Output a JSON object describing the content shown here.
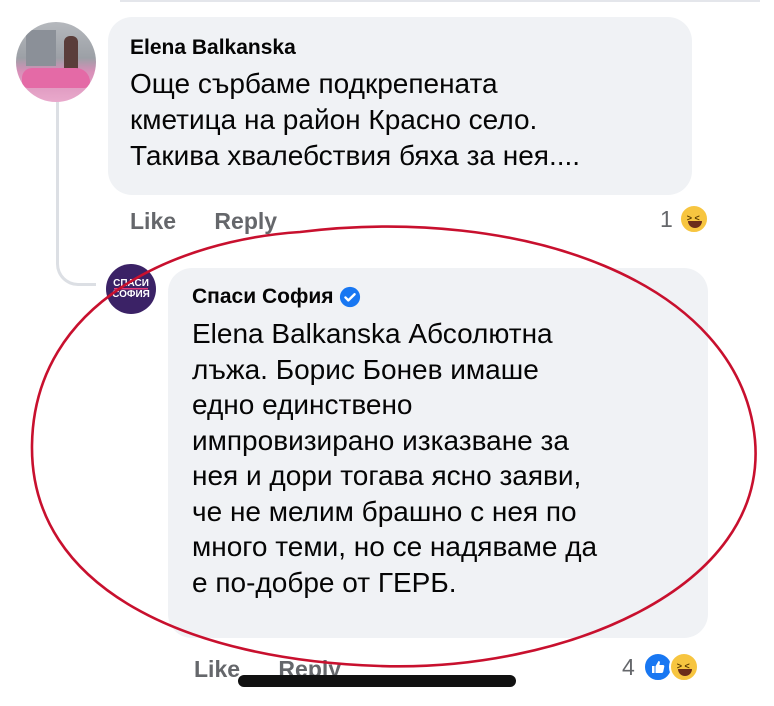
{
  "comment1": {
    "author": "Elena Balkanska",
    "text_lines": [
      "Още сърбаме подкрепената",
      "кметица на район Красно село.",
      "Такива хвалебствия бяха за нея...."
    ],
    "like_label": "Like",
    "reply_label": "Reply",
    "reaction_count": "1",
    "reaction_icons": [
      "haha-icon"
    ]
  },
  "comment2": {
    "author": "Спаси София",
    "avatar_text": [
      "СПАСИ",
      "СОФИЯ"
    ],
    "verified": true,
    "text_lines": [
      "Elena Balkanska Абсолютна",
      "лъжа. Борис Бонев имаше",
      "едно единствено",
      "импровизирано изказване за",
      "нея и дори тогава ясно заяви,",
      "че не мелим брашно с нея по",
      "много теми, но се надяваме да",
      "е по-добре от ГЕРБ."
    ],
    "like_label": "Like",
    "reply_label": "Reply",
    "reaction_count": "4",
    "reaction_icons": [
      "like-icon",
      "haha-icon"
    ]
  },
  "colors": {
    "bubble": "#f0f2f5",
    "action_text": "#65676b",
    "verified_blue": "#1877f2",
    "annotation_red": "#c8102e",
    "avatar2_bg": "#3b2266"
  }
}
